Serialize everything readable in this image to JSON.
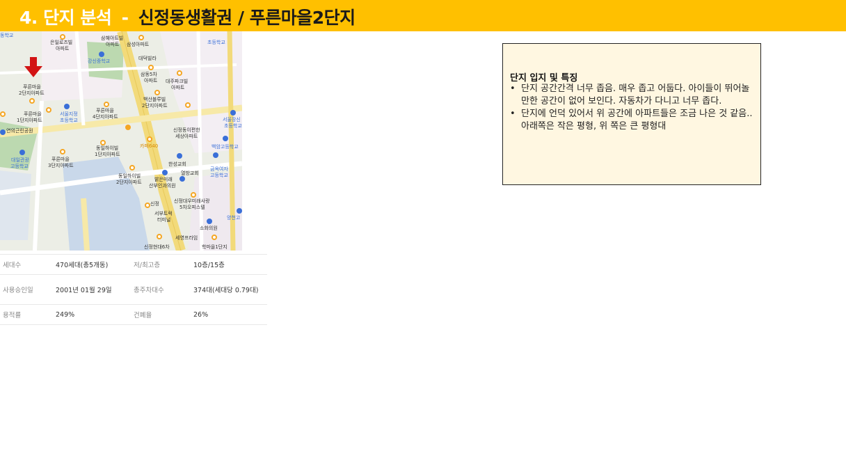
{
  "header": {
    "section_number": "4.",
    "section_label": "단지 분석",
    "separator": "-",
    "area_name": "신정동생활권 /",
    "complex_name": "푸른마을2단지"
  },
  "map": {
    "poi_labels": [
      "동학교",
      "은일로즈빌",
      "아파트",
      "삼혜아트빌",
      "아파트",
      "삼성아파트",
      "초등학교",
      "강신중학교",
      "대덕빌라",
      "푸른마을",
      "2단지아파트",
      "삼동5차",
      "아파트",
      "대주파크빌",
      "아파트",
      "백산블루빌",
      "2단지아파트",
      "푸른마을",
      "1단지아파트",
      "서울지정",
      "초등학교",
      "푸른마을",
      "4단지아파트",
      "연의근린공원",
      "서울장신",
      "초등학교",
      "신정동이편한",
      "세상아파트",
      "백암고등학교",
      "동일하이빌",
      "1단지아파트",
      "카페640",
      "대일관광",
      "고등학교",
      "푸른마을",
      "3단지아파트",
      "한성교회",
      "금옥여자",
      "고등학교",
      "동일하이빌",
      "2단지아파트",
      "밝은미래",
      "산부인과의원",
      "열방교회",
      "신정대우미래사랑",
      "5차오피스텔",
      "신정",
      "서부트럭",
      "터미널",
      "양천고",
      "소화의원",
      "세영프라임",
      "신정현대6차",
      "학마을1단지"
    ]
  },
  "table": {
    "rows": [
      {
        "k1": "세대수",
        "v1": "470세대(총5개동)",
        "k2": "저/최고층",
        "v2": "10층/15층"
      },
      {
        "k1": "사용승인일",
        "v1": "2001년 01월 29일",
        "k2": "총주차대수",
        "v2": "374대(세대당 0.79대)"
      },
      {
        "k1": "용적률",
        "v1": "249%",
        "k2": "건폐율",
        "v2": "26%"
      }
    ]
  },
  "notes": {
    "title": "단지 입지 및 특징",
    "bullet": "•",
    "items": [
      "단지 공간간격 너무 좁음. 매우 좁고 어둡다. 아이들이 뛰어놀 만한 공간이 없어 보인다. 자동차가 다니고 너무 좁다.",
      "단지에 언덕 있어서 위 공간에 아파트들은 조금 나은 것 같음.. 아래쪽은 작은 평형, 위 쪽은 큰 평형대"
    ]
  },
  "colors": {
    "title_bar": "#ffc000",
    "note_bg": "#fff7e1",
    "marker_red": "#d21414",
    "poi_orange": "#f5a623",
    "poi_blue": "#3a6fd8",
    "road_yellow": "#f2da7a"
  },
  "icons": {
    "location_marker": "red-down-arrow-icon",
    "poi": "circle-pin-icon",
    "school": "school-pin-icon"
  }
}
